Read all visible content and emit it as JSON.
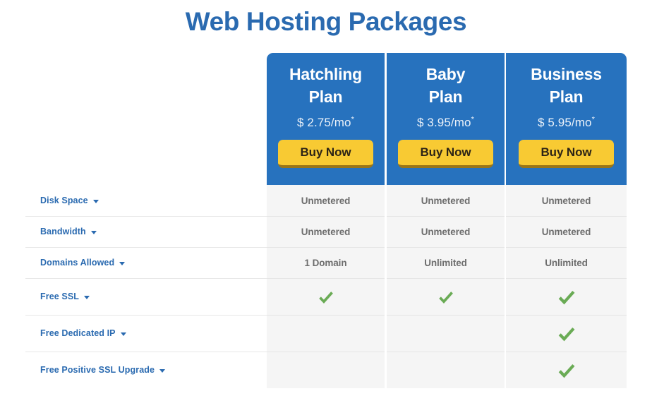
{
  "page": {
    "title": "Web Hosting Packages",
    "title_color": "#2a6ab0",
    "card_color": "#2772be",
    "button_color": "#f8ca33",
    "check_color": "#6aab55"
  },
  "plans": [
    {
      "name_line1": "Hatchling",
      "name_line2": "Plan",
      "price": "$ 2.75/mo",
      "price_asterisk": "*",
      "cta_label": "Buy Now"
    },
    {
      "name_line1": "Baby",
      "name_line2": "Plan",
      "price": "$ 3.95/mo",
      "price_asterisk": "*",
      "cta_label": "Buy Now"
    },
    {
      "name_line1": "Business",
      "name_line2": "Plan",
      "price": "$ 5.95/mo",
      "price_asterisk": "*",
      "cta_label": "Buy Now"
    }
  ],
  "features": [
    {
      "label": "Disk Space",
      "values": [
        "Unmetered",
        "Unmetered",
        "Unmetered"
      ],
      "types": [
        "text",
        "text",
        "text"
      ]
    },
    {
      "label": "Bandwidth",
      "values": [
        "Unmetered",
        "Unmetered",
        "Unmetered"
      ],
      "types": [
        "text",
        "text",
        "text"
      ]
    },
    {
      "label": "Domains Allowed",
      "values": [
        "1 Domain",
        "Unlimited",
        "Unlimited"
      ],
      "types": [
        "text",
        "text",
        "text"
      ]
    },
    {
      "label": "Free SSL",
      "values": [
        "check",
        "check",
        "check"
      ],
      "types": [
        "check",
        "check",
        "check"
      ]
    },
    {
      "label": "Free Dedicated IP",
      "values": [
        "",
        "",
        "check"
      ],
      "types": [
        "empty",
        "empty",
        "check"
      ]
    },
    {
      "label": "Free Positive SSL Upgrade",
      "values": [
        "",
        "",
        "check"
      ],
      "types": [
        "empty",
        "empty",
        "check"
      ]
    }
  ]
}
